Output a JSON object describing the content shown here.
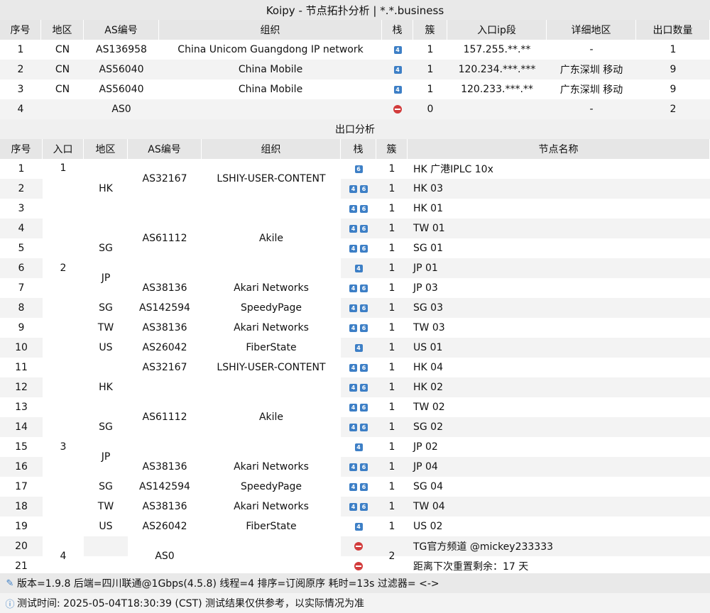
{
  "title": "Koipy - 节点拓扑分析 | *.*.business",
  "inbound": {
    "headers": [
      "序号",
      "地区",
      "AS编号",
      "组织",
      "栈",
      "簇",
      "入口ip段",
      "详细地区",
      "出口数量"
    ],
    "rows": [
      {
        "idx": "1",
        "region": "CN",
        "asn": "AS136958",
        "org": "China Unicom Guangdong IP network",
        "stack": "4",
        "cluster": "1",
        "ip": "157.255.**.**",
        "detail": "-",
        "count": "1"
      },
      {
        "idx": "2",
        "region": "CN",
        "asn": "AS56040",
        "org": "China Mobile",
        "stack": "4",
        "cluster": "1",
        "ip": "120.234.***.***",
        "detail": "广东深圳 移动",
        "count": "9"
      },
      {
        "idx": "3",
        "region": "CN",
        "asn": "AS56040",
        "org": "China Mobile",
        "stack": "4",
        "cluster": "1",
        "ip": "120.233.***.**",
        "detail": "广东深圳 移动",
        "count": "9"
      },
      {
        "idx": "4",
        "region": "",
        "asn": "AS0",
        "org": "",
        "stack": "none",
        "cluster": "0",
        "ip": "",
        "detail": "-",
        "count": "2"
      }
    ]
  },
  "outbound_title": "出口分析",
  "outbound": {
    "headers": [
      "序号",
      "入口",
      "地区",
      "AS编号",
      "组织",
      "栈",
      "簇",
      "节点名称"
    ],
    "rows": [
      {
        "idx": "1",
        "stack": "6",
        "cluster": "1",
        "node": "HK 广港IPLC 10x"
      },
      {
        "idx": "2",
        "stack": "46",
        "cluster": "1",
        "node": "HK 03"
      },
      {
        "idx": "3",
        "stack": "46",
        "cluster": "1",
        "node": "HK 01"
      },
      {
        "idx": "4",
        "stack": "46",
        "cluster": "1",
        "node": "TW 01"
      },
      {
        "idx": "5",
        "stack": "46",
        "cluster": "1",
        "node": "SG 01"
      },
      {
        "idx": "6",
        "stack": "4",
        "cluster": "1",
        "node": "JP 01"
      },
      {
        "idx": "7",
        "stack": "46",
        "cluster": "1",
        "node": "JP 03"
      },
      {
        "idx": "8",
        "stack": "46",
        "cluster": "1",
        "node": "SG 03"
      },
      {
        "idx": "9",
        "stack": "46",
        "cluster": "1",
        "node": "TW 03"
      },
      {
        "idx": "10",
        "stack": "4",
        "cluster": "1",
        "node": "US 01"
      },
      {
        "idx": "11",
        "stack": "46",
        "cluster": "1",
        "node": "HK 04"
      },
      {
        "idx": "12",
        "stack": "46",
        "cluster": "1",
        "node": "HK 02"
      },
      {
        "idx": "13",
        "stack": "46",
        "cluster": "1",
        "node": "TW 02"
      },
      {
        "idx": "14",
        "stack": "46",
        "cluster": "1",
        "node": "SG 02"
      },
      {
        "idx": "15",
        "stack": "4",
        "cluster": "1",
        "node": "JP 02"
      },
      {
        "idx": "16",
        "stack": "46",
        "cluster": "1",
        "node": "JP 04"
      },
      {
        "idx": "17",
        "stack": "46",
        "cluster": "1",
        "node": "SG 04"
      },
      {
        "idx": "18",
        "stack": "46",
        "cluster": "1",
        "node": "TW 04"
      },
      {
        "idx": "19",
        "stack": "4",
        "cluster": "1",
        "node": "US 02"
      },
      {
        "idx": "20",
        "stack": "none",
        "cluster": "",
        "node": "TG官方频道 @mickey233333"
      },
      {
        "idx": "21",
        "stack": "none",
        "cluster": "",
        "node": "距离下次重置剩余：17 天"
      }
    ],
    "merged": {
      "entry": [
        {
          "text": "1",
          "start": 1,
          "span": 1,
          "valign": "top"
        },
        {
          "text": "2",
          "start": 2,
          "span": 9
        },
        {
          "text": "3",
          "start": 11,
          "span": 9
        },
        {
          "text": "4",
          "start": 20,
          "span": 2
        }
      ],
      "region": [
        {
          "text": "HK",
          "start": 1,
          "span": 3
        },
        {
          "text": "",
          "start": 4,
          "span": 1
        },
        {
          "text": "SG",
          "start": 5,
          "span": 1
        },
        {
          "text": "JP",
          "start": 6,
          "span": 2
        },
        {
          "text": "SG",
          "start": 8,
          "span": 1
        },
        {
          "text": "TW",
          "start": 9,
          "span": 1
        },
        {
          "text": "US",
          "start": 10,
          "span": 1
        },
        {
          "text": "HK",
          "start": 11,
          "span": 3
        },
        {
          "text": "SG",
          "start": 14,
          "span": 1
        },
        {
          "text": "JP",
          "start": 15,
          "span": 2
        },
        {
          "text": "SG",
          "start": 17,
          "span": 1
        },
        {
          "text": "TW",
          "start": 18,
          "span": 1
        },
        {
          "text": "US",
          "start": 19,
          "span": 1
        }
      ],
      "asn": [
        {
          "text": "AS32167",
          "start": 1,
          "span": 2
        },
        {
          "text": "AS61112",
          "start": 3,
          "span": 4
        },
        {
          "text": "AS38136",
          "start": 7,
          "span": 1
        },
        {
          "text": "AS142594",
          "start": 8,
          "span": 1
        },
        {
          "text": "AS38136",
          "start": 9,
          "span": 1
        },
        {
          "text": "AS26042",
          "start": 10,
          "span": 1
        },
        {
          "text": "AS32167",
          "start": 11,
          "span": 1
        },
        {
          "text": "AS61112",
          "start": 12,
          "span": 4
        },
        {
          "text": "AS38136",
          "start": 16,
          "span": 1
        },
        {
          "text": "AS142594",
          "start": 17,
          "span": 1
        },
        {
          "text": "AS38136",
          "start": 18,
          "span": 1
        },
        {
          "text": "AS26042",
          "start": 19,
          "span": 1
        },
        {
          "text": "AS0",
          "start": 20,
          "span": 2
        }
      ],
      "org": [
        {
          "text": "LSHIY-USER-CONTENT",
          "start": 1,
          "span": 2
        },
        {
          "text": "Akile",
          "start": 3,
          "span": 4
        },
        {
          "text": "Akari Networks",
          "start": 7,
          "span": 1
        },
        {
          "text": "SpeedyPage",
          "start": 8,
          "span": 1
        },
        {
          "text": "Akari Networks",
          "start": 9,
          "span": 1
        },
        {
          "text": "FiberState",
          "start": 10,
          "span": 1
        },
        {
          "text": "LSHIY-USER-CONTENT",
          "start": 11,
          "span": 1
        },
        {
          "text": "Akile",
          "start": 12,
          "span": 4
        },
        {
          "text": "Akari Networks",
          "start": 16,
          "span": 1
        },
        {
          "text": "SpeedyPage",
          "start": 17,
          "span": 1
        },
        {
          "text": "Akari Networks",
          "start": 18,
          "span": 1
        },
        {
          "text": "FiberState",
          "start": 19,
          "span": 1
        },
        {
          "text": "",
          "start": 20,
          "span": 2
        }
      ],
      "cluster": [
        {
          "text": "2",
          "start": 20,
          "span": 2
        }
      ]
    }
  },
  "footer": {
    "line1": "版本=1.9.8  后端=四川联通@1Gbps(4.5.8)   线程=4  排序=订阅原序  耗时=13s    过滤器= <->",
    "line2": "测试时间: 2025-05-04T18:30:39 (CST)  测试结果仅供参考，以实际情况为准"
  },
  "colors": {
    "stack_tag": "#3d7fc6",
    "no_entry": "#d23c3c",
    "header_bg": "#e6e6e6",
    "stripe_bg": "#f3f3f3"
  }
}
